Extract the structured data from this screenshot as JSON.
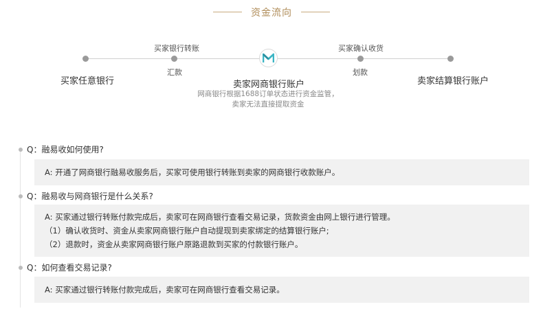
{
  "section_title": "资金流向",
  "flow": {
    "node_buyer_bank": "买家任意银行",
    "step1_top": "买家银行转账",
    "step1_bottom": "汇款",
    "node_center": "卖家网商银行账户",
    "center_desc_line1": "网商银行根据1688订单状态进行资金监管，",
    "center_desc_line2": "卖家无法直接提取资金",
    "step2_top": "买家确认收货",
    "step2_bottom": "划款",
    "node_seller_bank": "卖家结算银行账户",
    "logo_icon": "mybank-logo-icon",
    "logo_color": "#3bb5c4"
  },
  "faq": [
    {
      "question": "Q：融易收如何使用?",
      "answer_lines": [
        "A: 开通了网商银行融易收服务后，买家可使用银行转账到卖家的网商银行收款账户。"
      ]
    },
    {
      "question": "Q：融易收与网商银行是什么关系?",
      "answer_lines": [
        "A: 买家通过银行转账付款完成后，卖家可在网商银行查看交易记录，货款资金由网上银行进行管理。",
        "（1）确认收货时、资金从卖家网商银行账户自动提现到卖家绑定的结算银行账户;",
        "（2）退款时，资金从卖家网商银行账户原路退款到买家的付款银行账户。"
      ]
    },
    {
      "question": "Q：如何查看交易记录?",
      "answer_lines": [
        "A: 买家通过银行转账付款完成后，卖家可在网商银行查看交易记录。"
      ]
    }
  ],
  "colors": {
    "title_gold": "#b08d5a",
    "answer_bg": "#f1f1f1",
    "dot_gray": "#9a9a9a"
  }
}
